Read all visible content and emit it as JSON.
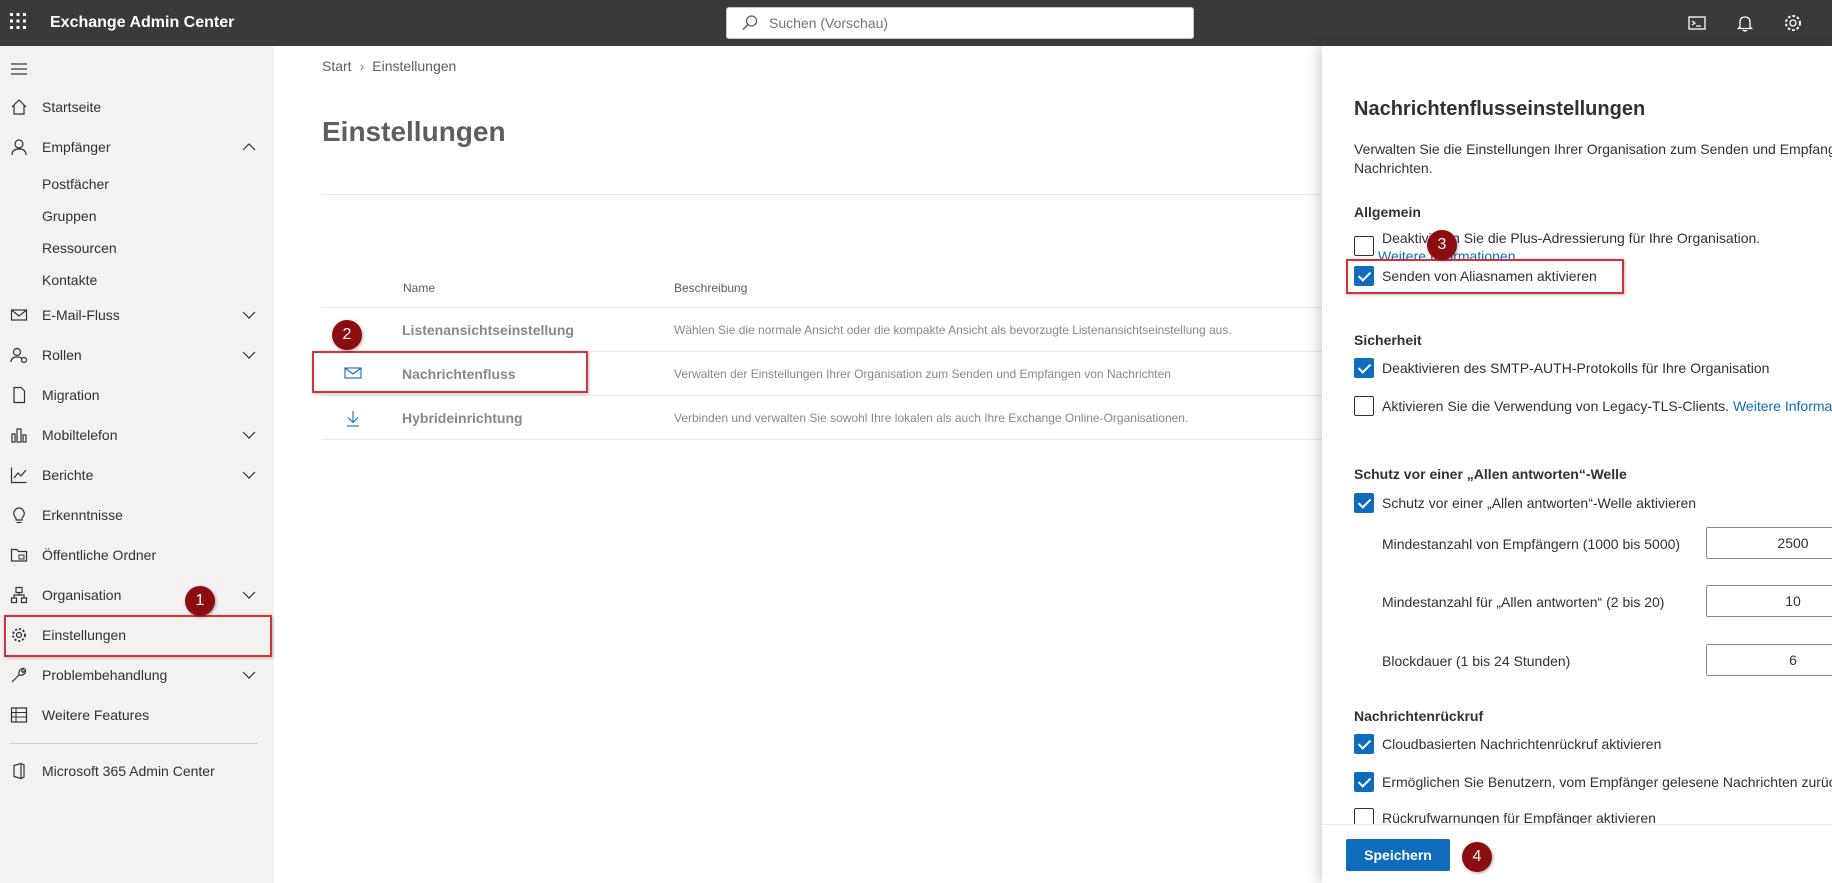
{
  "header": {
    "app_title": "Exchange Admin Center",
    "search_placeholder": "Suchen (Vorschau)",
    "icons": [
      "waffle-icon",
      "terminal-icon",
      "bell-icon",
      "gear-icon"
    ]
  },
  "nav": {
    "items": [
      {
        "label": "Startseite",
        "icon": "home-icon"
      },
      {
        "label": "Empfänger",
        "icon": "person-icon"
      },
      {
        "label": "E-Mail-Fluss",
        "icon": "mail-icon"
      },
      {
        "label": "Rollen",
        "icon": "roles-icon"
      },
      {
        "label": "Migration",
        "icon": "document-icon"
      },
      {
        "label": "Mobiltelefon",
        "icon": "phone-icon"
      },
      {
        "label": "Berichte",
        "icon": "chart-icon"
      },
      {
        "label": "Erkenntnisse",
        "icon": "lightbulb-icon"
      },
      {
        "label": "Öffentliche Ordner",
        "icon": "folder-icon"
      },
      {
        "label": "Organisation",
        "icon": "org-icon"
      },
      {
        "label": "Einstellungen",
        "icon": "gear-icon"
      },
      {
        "label": "Problembehandlung",
        "icon": "wrench-icon"
      },
      {
        "label": "Weitere Features",
        "icon": "grid-icon"
      },
      {
        "label": "Microsoft 365 Admin Center",
        "icon": "office-icon"
      }
    ],
    "sub_items": [
      "Postfächer",
      "Gruppen",
      "Ressourcen",
      "Kontakte"
    ]
  },
  "main": {
    "breadcrumb": [
      "Start",
      "Einstellungen"
    ],
    "title": "Einstellungen",
    "columns": [
      "Name",
      "Beschreibung"
    ],
    "rows": [
      {
        "name": "Listenansichtseinstellung",
        "desc": "Wählen Sie die normale Ansicht oder die kompakte Ansicht als bevorzugte Listenansichtseinstellung aus.",
        "icon": ""
      },
      {
        "name": "Nachrichtenfluss",
        "desc": "Verwalten der Einstellungen Ihrer Organisation zum Senden und Empfangen von Nachrichten",
        "icon": "mail-icon"
      },
      {
        "name": "Hybrideinrichtung",
        "desc": "Verbinden und verwalten Sie sowohl Ihre lokalen als auch Ihre Exchange Online-Organisationen.",
        "icon": "download-icon"
      }
    ]
  },
  "annotations": [
    "1",
    "2",
    "3",
    "4"
  ],
  "panel": {
    "title": "Nachrichtenflusseinstellungen",
    "desc_line1": "Verwalten Sie die Einstellungen Ihrer Organisation zum Senden und Empfangen",
    "desc_line2": "Nachrichten.",
    "general": {
      "heading": "Allgemein",
      "plus_addressing": "Deaktivieren Sie die Plus-Adressierung für Ihre Organisation.",
      "plus_link": "Weitere Informationen",
      "alias": "Senden von Aliasnamen aktivieren"
    },
    "security": {
      "heading": "Sicherheit",
      "smtp_auth": "Deaktivieren des SMTP-AUTH-Protokolls für Ihre Organisation",
      "legacy_tls": "Aktivieren Sie die Verwendung von Legacy-TLS-Clients.",
      "legacy_link": "Weitere Informationen"
    },
    "reply_all": {
      "heading": "Schutz vor einer „Allen antworten“-Welle",
      "enable": "Schutz vor einer „Allen antworten“-Welle aktivieren",
      "min_recipients_label": "Mindestanzahl von Empfängern (1000 bis 5000)",
      "min_recipients_value": "2500",
      "min_replies_label": "Mindestanzahl für „Allen antworten“ (2 bis 20)",
      "min_replies_value": "10",
      "block_duration_label": "Blockdauer (1 bis 24 Stunden)",
      "block_duration_value": "6"
    },
    "recall": {
      "heading": "Nachrichtenrückruf",
      "cloud_recall": "Cloudbasierten Nachrichtenrückruf aktivieren",
      "read_recall": "Ermöglichen Sie Benutzern, vom Empfänger gelesene Nachrichten zurückzurufen",
      "recall_warnings": "Rückrufwarnungen für Empfänger aktivieren"
    },
    "save_label": "Speichern"
  },
  "colors": {
    "accent": "#0f6cbd",
    "topbar": "#3b3a39",
    "highlight": "#d13438",
    "badge": "#8b0d10"
  }
}
